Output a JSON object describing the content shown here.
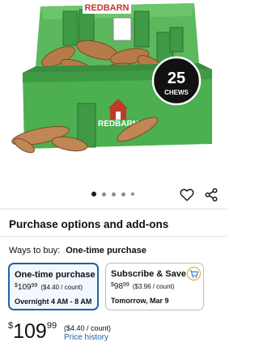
{
  "product_image": {
    "brand_text": "REDBARN",
    "badge_count": "25",
    "badge_label": "CHEWS",
    "box_color": "#4caf50",
    "box_dark": "#2f8a3a"
  },
  "carousel": {
    "dot_count": 5,
    "active_index": 0
  },
  "actions": {
    "favorite_icon": "heart-icon",
    "share_icon": "share-icon"
  },
  "section": {
    "title": "Purchase options and add-ons",
    "ways_label": "Ways to buy:",
    "ways_value": "One-time purchase"
  },
  "options": [
    {
      "title": "One-time purchase",
      "currency": "$",
      "price_whole": "109",
      "price_cents": "99",
      "unit_price": "($4.40 / count)",
      "delivery": "Overnight 4 AM - 8 AM",
      "selected": true
    },
    {
      "title": "Subscribe & Save",
      "currency": "$",
      "price_whole": "98",
      "price_cents": "99",
      "unit_price": "($3.96 / count)",
      "delivery": "Tomorrow, Mar 9",
      "selected": false
    }
  ],
  "price": {
    "currency": "$",
    "whole": "109",
    "cents": "99",
    "unit_price": "($4.40 / count)",
    "history_link": "Price history"
  },
  "colors": {
    "link": "#2162a1",
    "selected_border": "#2162a1",
    "subscribe_badge": "#e9a20c"
  }
}
